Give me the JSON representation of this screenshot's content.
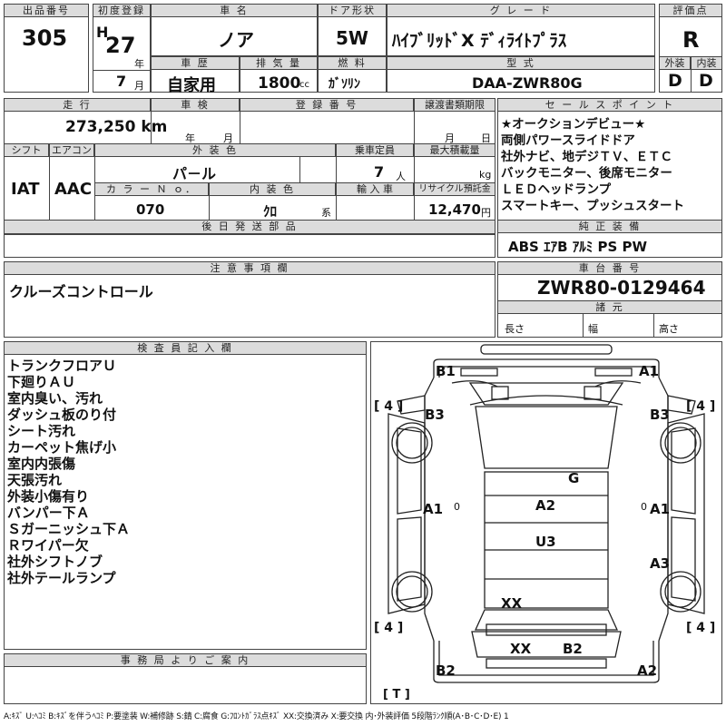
{
  "top": {
    "lot_label": "出品番号",
    "lot_number": "305",
    "first_reg_label": "初度登録",
    "era": "H",
    "year": "27",
    "year_unit": "年",
    "month": "7",
    "month_unit": "月",
    "car_name_label": "車 名",
    "car_name": "ノア",
    "history_label": "車 歴",
    "history": "自家用",
    "displacement_label": "排 気 量",
    "displacement": "1800",
    "displacement_unit": "cc",
    "door_label": "ドア形状",
    "door": "5W",
    "fuel_label": "燃 料",
    "fuel": "ｶﾞｿﾘﾝ",
    "grade_label": "グ レ ー ド",
    "grade": "ﾊｲﾌﾞﾘｯﾄﾞX ﾃﾞｨﾗｲﾄﾌﾟﾗｽ",
    "model_label": "型 式",
    "model": "DAA-ZWR80G",
    "score_label": "評価点",
    "score": "R",
    "exterior_label": "外装",
    "exterior": "D",
    "interior_label": "内装",
    "interior": "D"
  },
  "row2": {
    "mileage_label": "走 行",
    "mileage": "273,250 km",
    "inspection_label": "車 検",
    "inspection_year_unit": "年",
    "inspection_month_unit": "月",
    "reg_label": "登 録 番 号",
    "transfer_label": "譲渡書類期限",
    "transfer_month_unit": "月",
    "transfer_day_unit": "日",
    "shift_label": "シフト",
    "shift": "IAT",
    "ac_label": "エアコン",
    "ac": "AAC",
    "color_label": "外 装 色",
    "color": "パ－ル",
    "capacity_label": "乗車定員",
    "capacity": "7",
    "capacity_unit": "人",
    "load_label": "最大積載量",
    "load_unit": "kg",
    "color_no_label": "カ ラ ー Ｎ ｏ．",
    "color_no": "070",
    "int_color_label": "内 装 色",
    "int_color": "ｸﾛ",
    "int_color_unit": "系",
    "import_label": "輸 入 車",
    "recycle_label": "リサイクル預託金",
    "recycle": "12,470",
    "recycle_unit": "円",
    "parts_label": "後 日 発 送 部 品"
  },
  "sales": {
    "label": "セ ー ル ス ポ イ ン ト",
    "lines": [
      "★オークションデビュー★",
      "両側パワースライドドア",
      "社外ナビ、地デジＴＶ、ＥＴＣ",
      "バックモニター、後席モニター",
      "ＬＥＤヘッドランプ",
      "スマートキー、プッシュスタート"
    ],
    "equip_label": "純 正 装 備",
    "equip": "ABS ｴｱB ｱﾙﾐ PS PW"
  },
  "notes": {
    "label": "注 意 事 項 欄",
    "text": "クルーズコントロール"
  },
  "chassis": {
    "label": "車 台 番 号",
    "number": "ZWR80-0129464",
    "dims_label": "諸 元",
    "length_label": "長さ",
    "width_label": "幅",
    "height_label": "高さ"
  },
  "inspector": {
    "label": "検 査 員 記 入 欄",
    "lines": [
      "トランクフロアＵ",
      "下廻りＡＵ",
      "室内臭い、汚れ",
      "ダッシュ板のり付",
      "シート汚れ",
      "カーペット焦げ小",
      "室内内張傷",
      "天張汚れ",
      "外装小傷有り",
      "バンパー下Ａ",
      "Ｓガーニッシュ下Ａ",
      "Ｒワイパー欠",
      "社外シフトノブ",
      "社外テールランプ"
    ]
  },
  "office": {
    "label": "事 務 局 よ り ご 案 内"
  },
  "diagram": {
    "marks": {
      "b1": "B1",
      "a1_top": "A1",
      "b3_left": "B3",
      "b3_right": "B3",
      "g": "G",
      "a1_left": "A1",
      "a2_center": "A2",
      "a1_right": "A1",
      "u3": "U3",
      "a3_right": "A3",
      "xx_center": "XX",
      "xx_bottom": "XX",
      "b2_bottom": "B2",
      "b2_left": "B2",
      "a2_right": "A2"
    },
    "tires": {
      "tl": "[ 4 ]",
      "tr": "[ 4 ]",
      "bl": "[ 4 ]",
      "br": "[ 4 ]"
    },
    "spare": "[ T ]",
    "zero": "0"
  },
  "legend": {
    "text": "A:ｷｽﾞ U:ﾍｺﾐ B:ｷｽﾞを伴うﾍｺﾐ P:要塗装 W:補修跡 S:錆 C:腐食 G:ﾌﾛﾝﾄｶﾞﾗｽ点ｷｽﾞ XX:交換済み X:要交換 内･外装評価 5段階ﾗﾝｸ順(A･B･C･D･E) 1"
  }
}
